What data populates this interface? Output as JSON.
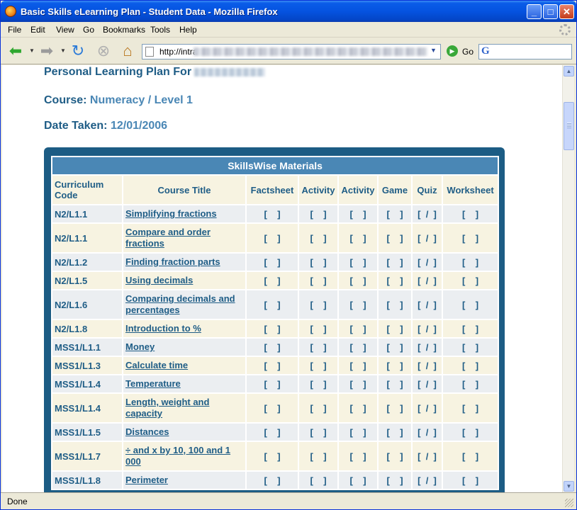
{
  "window": {
    "title": "Basic Skills eLearning Plan - Student Data - Mozilla Firefox"
  },
  "menu": [
    "File",
    "Edit",
    "View",
    "Go",
    "Bookmarks",
    "Tools",
    "Help"
  ],
  "navbar": {
    "url_prefix": "http://intra",
    "go_label": "Go",
    "search_engine": "G"
  },
  "status": {
    "text": "Done"
  },
  "page": {
    "heading_label": "Personal Learning Plan For",
    "course_label": "Course:",
    "course_value": "Numeracy / Level 1",
    "date_label": "Date Taken:",
    "date_value": "12/01/2006"
  },
  "table": {
    "caption": "SkillsWise Materials",
    "headers": [
      "Curriculum Code",
      "Course Title",
      "Factsheet",
      "Activity",
      "Activity",
      "Game",
      "Quiz",
      "Worksheet"
    ],
    "marks": [
      "[    ]",
      "[    ]",
      "[    ]",
      "[    ]",
      "[  /  ]",
      "[    ]"
    ],
    "rows": [
      {
        "code": "N2/L1.1",
        "title": "Simplifying fractions"
      },
      {
        "code": "N2/L1.1",
        "title": "Compare and order fractions"
      },
      {
        "code": "N2/L1.2",
        "title": "Finding fraction parts"
      },
      {
        "code": "N2/L1.5",
        "title": "Using decimals"
      },
      {
        "code": "N2/L1.6",
        "title": "Comparing decimals and percentages"
      },
      {
        "code": "N2/L1.8",
        "title": "Introduction to %"
      },
      {
        "code": "MSS1/L1.1",
        "title": "Money"
      },
      {
        "code": "MSS1/L1.3",
        "title": "Calculate time"
      },
      {
        "code": "MSS1/L1.4",
        "title": "Temperature"
      },
      {
        "code": "MSS1/L1.4",
        "title": "Length, weight and capacity"
      },
      {
        "code": "MSS1/L1.5",
        "title": "Distances"
      },
      {
        "code": "MSS1/L1.7",
        "title": "÷ and x by 10, 100 and 1 000"
      },
      {
        "code": "MSS1/L1.8",
        "title": "Perimeter"
      }
    ]
  }
}
